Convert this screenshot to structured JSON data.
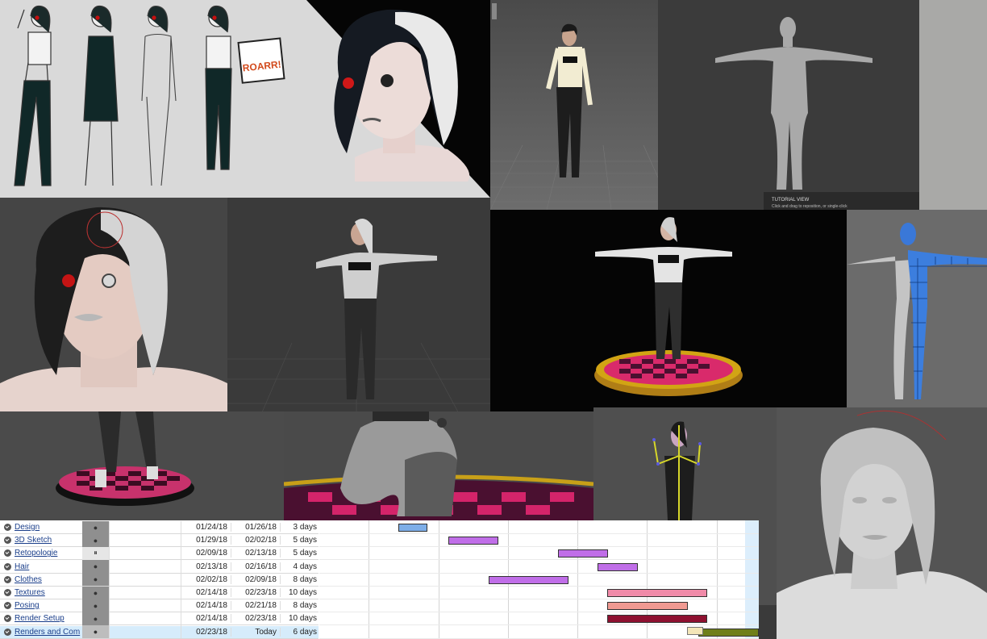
{
  "tasks": [
    {
      "name": "Design",
      "status": "●",
      "start": "01/24/18",
      "end": "01/26/18",
      "duration": "3 days",
      "color": "#7eaee8"
    },
    {
      "name": "3D Sketch",
      "status": "●",
      "start": "01/29/18",
      "end": "02/02/18",
      "duration": "5 days",
      "color": "#c06ee8"
    },
    {
      "name": "Retopologie",
      "status": "⏸",
      "start": "02/09/18",
      "end": "02/13/18",
      "duration": "5 days",
      "color": "#c06ee8"
    },
    {
      "name": "Hair",
      "status": "●",
      "start": "02/13/18",
      "end": "02/16/18",
      "duration": "4 days",
      "color": "#c06ee8"
    },
    {
      "name": "Clothes",
      "status": "●",
      "start": "02/02/18",
      "end": "02/09/18",
      "duration": "8 days",
      "color": "#c06ee8"
    },
    {
      "name": "Textures",
      "status": "●",
      "start": "02/14/18",
      "end": "02/23/18",
      "duration": "10 days",
      "color": "#f08aa8"
    },
    {
      "name": "Posing",
      "status": "●",
      "start": "02/14/18",
      "end": "02/21/18",
      "duration": "8 days",
      "color": "#f09a92"
    },
    {
      "name": "Render Setup",
      "status": "●",
      "start": "02/14/18",
      "end": "02/23/18",
      "duration": "10 days",
      "color": "#8e1030"
    },
    {
      "name": "Renders and Com",
      "status": "●",
      "start": "02/23/18",
      "end": "Today",
      "duration": "6 days",
      "color": "#6f7f1a"
    }
  ],
  "tutorial": {
    "title": "TUTORIAL VIEW",
    "hint": "Click and drag to reposition, or single-click"
  },
  "sketch_sign": "ROARR!"
}
